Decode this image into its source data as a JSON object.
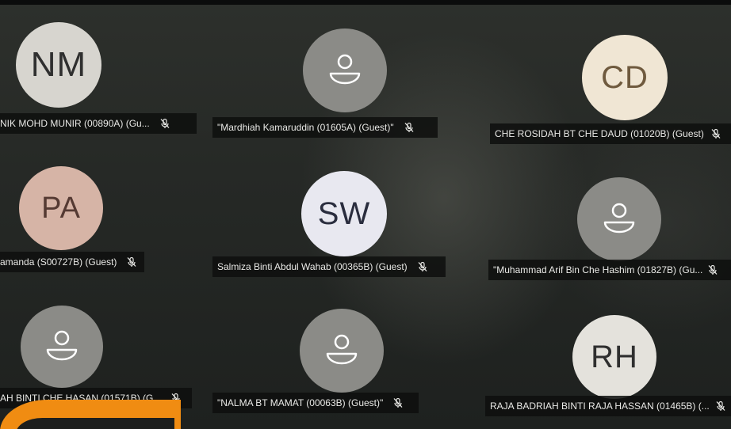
{
  "participants": [
    {
      "initials": "NM",
      "name": "NIK MOHD MUNIR (00890A) (Gu...",
      "muted": true
    },
    {
      "initials": "",
      "name": "\"Mardhiah Kamaruddin (01605A) (Guest)\"",
      "muted": true
    },
    {
      "initials": "CD",
      "name": "CHE ROSIDAH BT CHE DAUD (01020B) (Guest)",
      "muted": true
    },
    {
      "initials": "PA",
      "name": "amanda (S00727B) (Guest)",
      "muted": true
    },
    {
      "initials": "SW",
      "name": "Salmiza Binti Abdul Wahab (00365B) (Guest)",
      "muted": true
    },
    {
      "initials": "",
      "name": "\"Muhammad Arif Bin Che Hashim (01827B) (Gu...",
      "muted": true
    },
    {
      "initials": "",
      "name": "AH BINTI CHE HASAN (01571B) (G...",
      "muted": true
    },
    {
      "initials": "",
      "name": "\"NALMA BT MAMAT (00063B) (Guest)\"",
      "muted": true
    },
    {
      "initials": "RH",
      "name": "RAJA BADRIAH BINTI RAJA HASSAN (01465B) (...",
      "muted": true
    }
  ],
  "icons": {
    "mic_muted": "mic-muted-icon",
    "default_avatar": "person-icon"
  },
  "colors": {
    "accent": "#f08c12",
    "name_plate_bg": "#0e0f0e",
    "name_plate_text": "#e9e9e6"
  }
}
